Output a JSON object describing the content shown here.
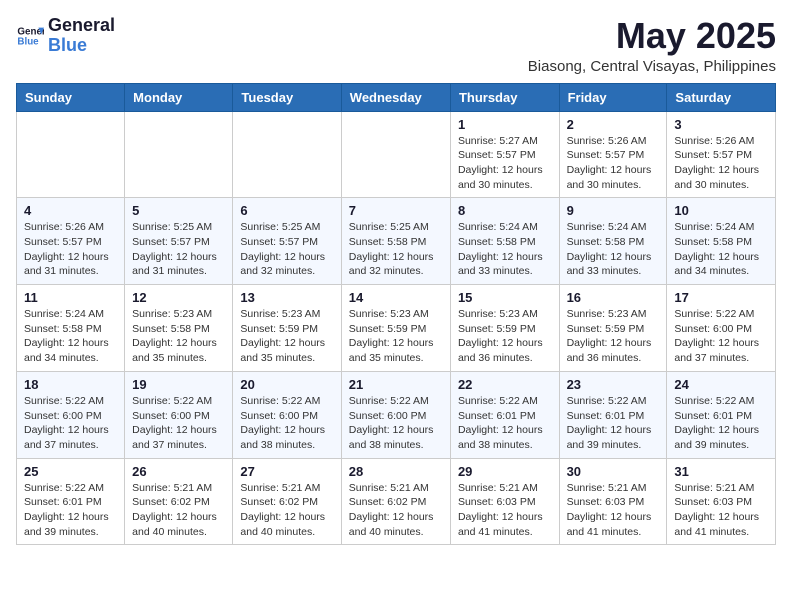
{
  "header": {
    "logo_general": "General",
    "logo_blue": "Blue",
    "month_year": "May 2025",
    "location": "Biasong, Central Visayas, Philippines"
  },
  "weekdays": [
    "Sunday",
    "Monday",
    "Tuesday",
    "Wednesday",
    "Thursday",
    "Friday",
    "Saturday"
  ],
  "weeks": [
    [
      {
        "day": "",
        "info": ""
      },
      {
        "day": "",
        "info": ""
      },
      {
        "day": "",
        "info": ""
      },
      {
        "day": "",
        "info": ""
      },
      {
        "day": "1",
        "info": "Sunrise: 5:27 AM\nSunset: 5:57 PM\nDaylight: 12 hours\nand 30 minutes."
      },
      {
        "day": "2",
        "info": "Sunrise: 5:26 AM\nSunset: 5:57 PM\nDaylight: 12 hours\nand 30 minutes."
      },
      {
        "day": "3",
        "info": "Sunrise: 5:26 AM\nSunset: 5:57 PM\nDaylight: 12 hours\nand 30 minutes."
      }
    ],
    [
      {
        "day": "4",
        "info": "Sunrise: 5:26 AM\nSunset: 5:57 PM\nDaylight: 12 hours\nand 31 minutes."
      },
      {
        "day": "5",
        "info": "Sunrise: 5:25 AM\nSunset: 5:57 PM\nDaylight: 12 hours\nand 31 minutes."
      },
      {
        "day": "6",
        "info": "Sunrise: 5:25 AM\nSunset: 5:57 PM\nDaylight: 12 hours\nand 32 minutes."
      },
      {
        "day": "7",
        "info": "Sunrise: 5:25 AM\nSunset: 5:58 PM\nDaylight: 12 hours\nand 32 minutes."
      },
      {
        "day": "8",
        "info": "Sunrise: 5:24 AM\nSunset: 5:58 PM\nDaylight: 12 hours\nand 33 minutes."
      },
      {
        "day": "9",
        "info": "Sunrise: 5:24 AM\nSunset: 5:58 PM\nDaylight: 12 hours\nand 33 minutes."
      },
      {
        "day": "10",
        "info": "Sunrise: 5:24 AM\nSunset: 5:58 PM\nDaylight: 12 hours\nand 34 minutes."
      }
    ],
    [
      {
        "day": "11",
        "info": "Sunrise: 5:24 AM\nSunset: 5:58 PM\nDaylight: 12 hours\nand 34 minutes."
      },
      {
        "day": "12",
        "info": "Sunrise: 5:23 AM\nSunset: 5:58 PM\nDaylight: 12 hours\nand 35 minutes."
      },
      {
        "day": "13",
        "info": "Sunrise: 5:23 AM\nSunset: 5:59 PM\nDaylight: 12 hours\nand 35 minutes."
      },
      {
        "day": "14",
        "info": "Sunrise: 5:23 AM\nSunset: 5:59 PM\nDaylight: 12 hours\nand 35 minutes."
      },
      {
        "day": "15",
        "info": "Sunrise: 5:23 AM\nSunset: 5:59 PM\nDaylight: 12 hours\nand 36 minutes."
      },
      {
        "day": "16",
        "info": "Sunrise: 5:23 AM\nSunset: 5:59 PM\nDaylight: 12 hours\nand 36 minutes."
      },
      {
        "day": "17",
        "info": "Sunrise: 5:22 AM\nSunset: 6:00 PM\nDaylight: 12 hours\nand 37 minutes."
      }
    ],
    [
      {
        "day": "18",
        "info": "Sunrise: 5:22 AM\nSunset: 6:00 PM\nDaylight: 12 hours\nand 37 minutes."
      },
      {
        "day": "19",
        "info": "Sunrise: 5:22 AM\nSunset: 6:00 PM\nDaylight: 12 hours\nand 37 minutes."
      },
      {
        "day": "20",
        "info": "Sunrise: 5:22 AM\nSunset: 6:00 PM\nDaylight: 12 hours\nand 38 minutes."
      },
      {
        "day": "21",
        "info": "Sunrise: 5:22 AM\nSunset: 6:00 PM\nDaylight: 12 hours\nand 38 minutes."
      },
      {
        "day": "22",
        "info": "Sunrise: 5:22 AM\nSunset: 6:01 PM\nDaylight: 12 hours\nand 38 minutes."
      },
      {
        "day": "23",
        "info": "Sunrise: 5:22 AM\nSunset: 6:01 PM\nDaylight: 12 hours\nand 39 minutes."
      },
      {
        "day": "24",
        "info": "Sunrise: 5:22 AM\nSunset: 6:01 PM\nDaylight: 12 hours\nand 39 minutes."
      }
    ],
    [
      {
        "day": "25",
        "info": "Sunrise: 5:22 AM\nSunset: 6:01 PM\nDaylight: 12 hours\nand 39 minutes."
      },
      {
        "day": "26",
        "info": "Sunrise: 5:21 AM\nSunset: 6:02 PM\nDaylight: 12 hours\nand 40 minutes."
      },
      {
        "day": "27",
        "info": "Sunrise: 5:21 AM\nSunset: 6:02 PM\nDaylight: 12 hours\nand 40 minutes."
      },
      {
        "day": "28",
        "info": "Sunrise: 5:21 AM\nSunset: 6:02 PM\nDaylight: 12 hours\nand 40 minutes."
      },
      {
        "day": "29",
        "info": "Sunrise: 5:21 AM\nSunset: 6:03 PM\nDaylight: 12 hours\nand 41 minutes."
      },
      {
        "day": "30",
        "info": "Sunrise: 5:21 AM\nSunset: 6:03 PM\nDaylight: 12 hours\nand 41 minutes."
      },
      {
        "day": "31",
        "info": "Sunrise: 5:21 AM\nSunset: 6:03 PM\nDaylight: 12 hours\nand 41 minutes."
      }
    ]
  ]
}
